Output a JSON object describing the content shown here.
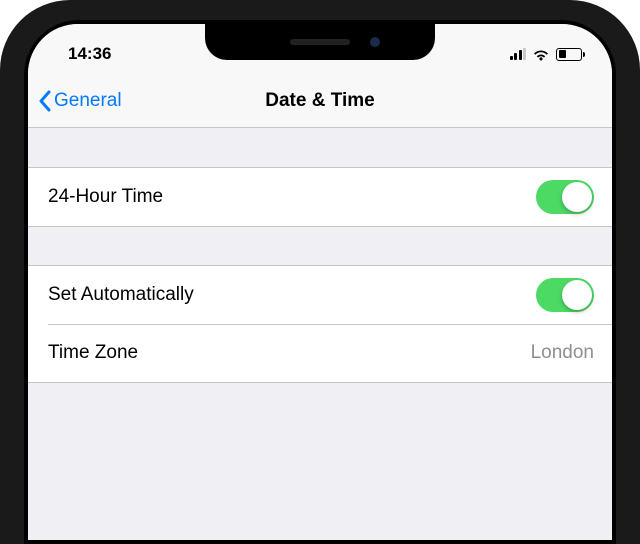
{
  "statusbar": {
    "time": "14:36"
  },
  "nav": {
    "back_label": "General",
    "title": "Date & Time"
  },
  "rows": {
    "twenty_four_hour": {
      "label": "24-Hour Time",
      "on": true
    },
    "set_automatically": {
      "label": "Set Automatically",
      "on": true
    },
    "time_zone": {
      "label": "Time Zone",
      "value": "London"
    }
  },
  "colors": {
    "accent": "#007aff",
    "toggle_on": "#4cd964",
    "secondary_text": "#8e8e93",
    "grouped_bg": "#efeff4"
  }
}
